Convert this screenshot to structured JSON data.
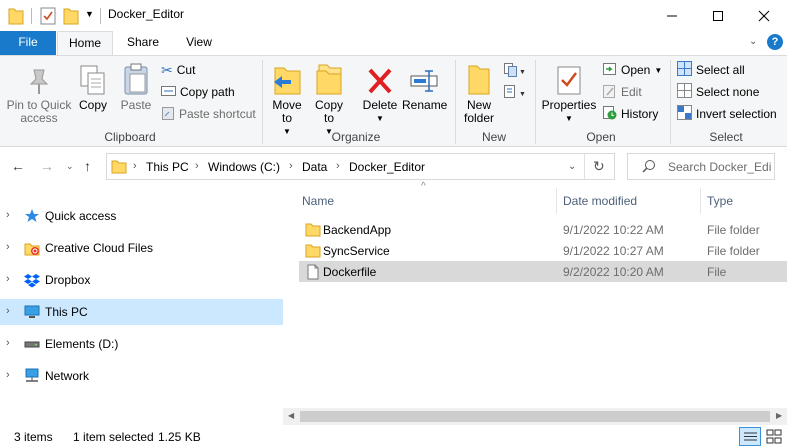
{
  "window": {
    "title": "Docker_Editor"
  },
  "tabs": [
    {
      "label": "File"
    },
    {
      "label": "Home"
    },
    {
      "label": "Share"
    },
    {
      "label": "View"
    }
  ],
  "ribbon": {
    "clipboard": {
      "label": "Clipboard",
      "pin": "Pin to Quick access",
      "copy": "Copy",
      "paste": "Paste",
      "cut": "Cut",
      "copy_path": "Copy path",
      "paste_shortcut": "Paste shortcut"
    },
    "organize": {
      "label": "Organize",
      "move_to": "Move to",
      "copy_to": "Copy to",
      "delete": "Delete",
      "rename": "Rename"
    },
    "new": {
      "label": "New",
      "new_folder": "New folder"
    },
    "open": {
      "label": "Open",
      "properties": "Properties",
      "open": "Open",
      "edit": "Edit",
      "history": "History"
    },
    "select": {
      "label": "Select",
      "select_all": "Select all",
      "select_none": "Select none",
      "invert": "Invert selection"
    }
  },
  "address": {
    "crumbs": [
      "This PC",
      "Windows (C:)",
      "Data",
      "Docker_Editor"
    ],
    "search_placeholder": "Search Docker_Edi..."
  },
  "nav": [
    {
      "label": "Quick access",
      "icon": "star-icon"
    },
    {
      "label": "Creative Cloud Files",
      "icon": "creative-cloud-icon"
    },
    {
      "label": "Dropbox",
      "icon": "dropbox-icon"
    },
    {
      "label": "This PC",
      "icon": "computer-icon",
      "selected": true
    },
    {
      "label": "Elements (D:)",
      "icon": "drive-icon"
    },
    {
      "label": "Network",
      "icon": "network-icon"
    }
  ],
  "columns": {
    "name": "Name",
    "date": "Date modified",
    "type": "Type"
  },
  "files": [
    {
      "name": "BackendApp",
      "date": "9/1/2022 10:22 AM",
      "type": "File folder",
      "icon": "folder-icon"
    },
    {
      "name": "SyncService",
      "date": "9/1/2022 10:27 AM",
      "type": "File folder",
      "icon": "folder-icon"
    },
    {
      "name": "Dockerfile",
      "date": "9/2/2022 10:20 AM",
      "type": "File",
      "icon": "file-icon",
      "selected": true
    }
  ],
  "status": {
    "count": "3 items",
    "selected": "1 item selected",
    "size": "1.25 KB"
  },
  "colors": {
    "accent": "#1979ca",
    "selection": "#cce8ff",
    "folder": "#ffd866"
  }
}
